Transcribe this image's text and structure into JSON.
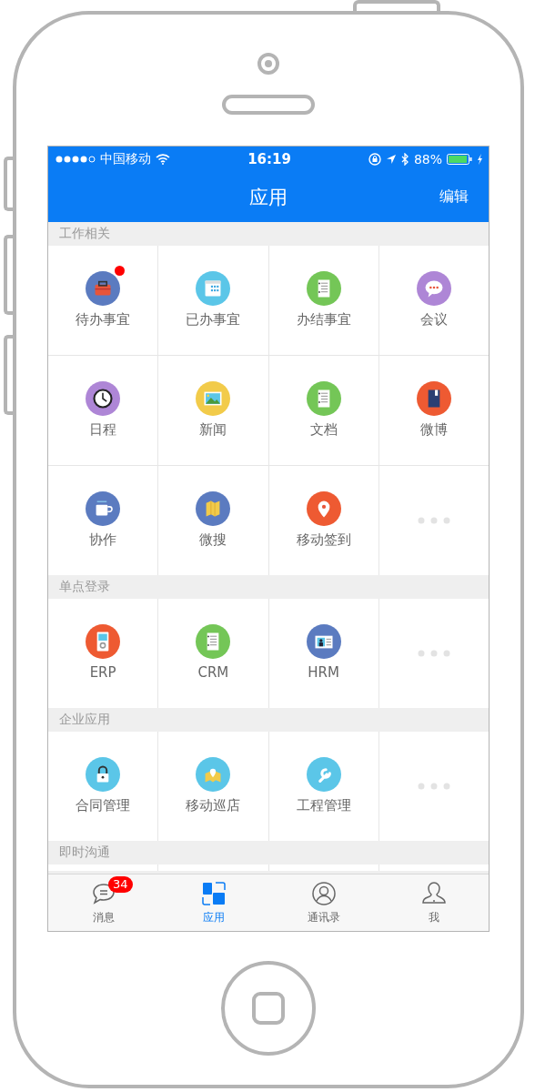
{
  "status_bar": {
    "carrier": "中国移动",
    "time": "16:19",
    "battery": "88%"
  },
  "nav": {
    "title": "应用",
    "action": "编辑"
  },
  "sections": [
    {
      "title": "工作相关",
      "items": [
        {
          "kind": "toolbox",
          "label": "待办事宜",
          "color": "#5b7bc0",
          "badge": true
        },
        {
          "kind": "calendar",
          "label": "已办事宜",
          "color": "#5bc6e8",
          "badge": false
        },
        {
          "kind": "document",
          "label": "办结事宜",
          "color": "#74c657",
          "badge": false
        },
        {
          "kind": "chat",
          "label": "会议",
          "color": "#ae86d6",
          "badge": false
        },
        {
          "kind": "clock",
          "label": "日程",
          "color": "#ae86d6",
          "badge": false
        },
        {
          "kind": "image",
          "label": "新闻",
          "color": "#f2cb4a",
          "badge": false
        },
        {
          "kind": "document",
          "label": "文档",
          "color": "#74c657",
          "badge": false
        },
        {
          "kind": "book",
          "label": "微博",
          "color": "#ee5a32",
          "badge": false
        },
        {
          "kind": "cup",
          "label": "协作",
          "color": "#5b7bc0",
          "badge": false
        },
        {
          "kind": "map",
          "label": "微搜",
          "color": "#5b7bc0",
          "badge": false
        },
        {
          "kind": "pin",
          "label": "移动签到",
          "color": "#ee5a32",
          "badge": false
        },
        {
          "kind": "more"
        }
      ]
    },
    {
      "title": "单点登录",
      "items": [
        {
          "kind": "player",
          "label": "ERP",
          "color": "#ee5a32",
          "badge": false
        },
        {
          "kind": "document",
          "label": "CRM",
          "color": "#74c657",
          "badge": false
        },
        {
          "kind": "idcard",
          "label": "HRM",
          "color": "#5b7bc0",
          "badge": false
        },
        {
          "kind": "more"
        }
      ]
    },
    {
      "title": "企业应用",
      "items": [
        {
          "kind": "lock",
          "label": "合同管理",
          "color": "#5bc6e8",
          "badge": false
        },
        {
          "kind": "mappin",
          "label": "移动巡店",
          "color": "#5bc6e8",
          "badge": false
        },
        {
          "kind": "wrench",
          "label": "工程管理",
          "color": "#5bc6e8",
          "badge": false
        },
        {
          "kind": "more"
        }
      ]
    },
    {
      "title": "即时沟通"
    }
  ],
  "tabs": [
    {
      "kind": "message",
      "label": "消息",
      "selected": false,
      "badge": "34"
    },
    {
      "kind": "apps",
      "label": "应用",
      "selected": true
    },
    {
      "kind": "contacts",
      "label": "通讯录",
      "selected": false
    },
    {
      "kind": "me",
      "label": "我",
      "selected": false
    }
  ]
}
